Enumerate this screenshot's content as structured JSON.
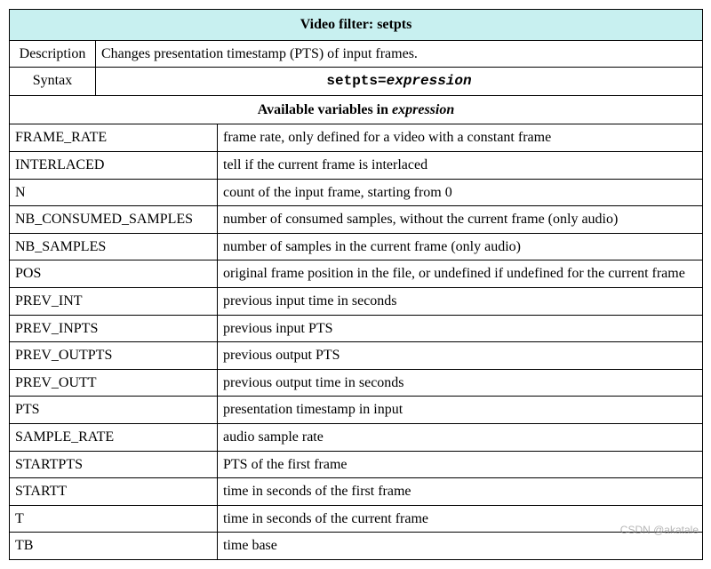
{
  "title": "Video filter: setpts",
  "description_label": "Description",
  "description_value": "Changes presentation timestamp (PTS) of input frames.",
  "syntax_label": "Syntax",
  "syntax_value_pre": "setpts=",
  "syntax_value_expr": "expression",
  "vars_header_pre": "Available variables in ",
  "vars_header_expr": "expression",
  "vars": [
    {
      "name": "FRAME_RATE",
      "desc": "frame rate, only defined for a video with a constant frame"
    },
    {
      "name": "INTERLACED",
      "desc": "tell if the current frame is interlaced"
    },
    {
      "name": "N",
      "desc": "count of the input frame, starting from 0"
    },
    {
      "name": "NB_CONSUMED_SAMPLES",
      "desc": "number of consumed samples, without the current frame (only audio)"
    },
    {
      "name": "NB_SAMPLES",
      "desc": "number of samples in the current frame (only audio)"
    },
    {
      "name": "POS",
      "desc": "original frame position in the file, or undefined if undefined for the current frame"
    },
    {
      "name": "PREV_INT",
      "desc": "previous input time in seconds"
    },
    {
      "name": "PREV_INPTS",
      "desc": "previous input PTS"
    },
    {
      "name": "PREV_OUTPTS",
      "desc": "previous output PTS"
    },
    {
      "name": "PREV_OUTT",
      "desc": "previous output time in seconds"
    },
    {
      "name": "PTS",
      "desc": "presentation timestamp in input"
    },
    {
      "name": "SAMPLE_RATE",
      "desc": "audio sample rate"
    },
    {
      "name": "STARTPTS",
      "desc": "PTS of the first frame"
    },
    {
      "name": "STARTT",
      "desc": "time in seconds of the first frame"
    },
    {
      "name": "T",
      "desc": "time in seconds of the current frame"
    },
    {
      "name": "TB",
      "desc": "time base"
    }
  ],
  "watermark": "CSDN @akatale"
}
